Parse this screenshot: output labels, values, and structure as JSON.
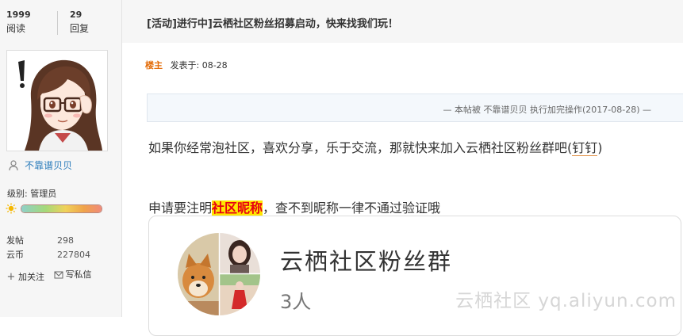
{
  "stats": {
    "reads_value": "1999",
    "reads_label": "阅读",
    "replies_value": "29",
    "replies_label": "回复"
  },
  "user": {
    "username": "不靠谱贝贝",
    "level_label": "级别:",
    "level_value": "管理员",
    "level_progress": 1.0,
    "posts_label": "发帖",
    "posts_value": "298",
    "coins_label": "云币",
    "coins_value": "227804",
    "follow_label": "加关注",
    "message_label": "写私信"
  },
  "thread": {
    "tag": "[活动]进行中]",
    "title": "云栖社区粉丝招募启动，快来找我们玩！",
    "owner_label": "楼主",
    "posted_at": "发表于: 08-28",
    "edit_note": "— 本帖被 不靠谱贝贝 执行加完操作(2017-08-28) —"
  },
  "content": {
    "line1_text": "如果你经常泡社区，喜欢分享，乐于交流，那就快来加入云栖社区粉丝群吧(",
    "line1_dingding": "钉钉",
    "line1_close": ")",
    "line2_pre": "申请要注明",
    "line2_highlight": "社区昵称",
    "line2_post": "，查不到昵称一律不通过验证哦"
  },
  "group": {
    "name": "云栖社区粉丝群",
    "member_count": "3人"
  },
  "watermark": "云栖社区 yq.aliyun.com",
  "colors": {
    "owner": "#e36c09",
    "username": "#2b7cbb",
    "highlight_bg": "#ffe600",
    "highlight_text": "#e60012"
  }
}
